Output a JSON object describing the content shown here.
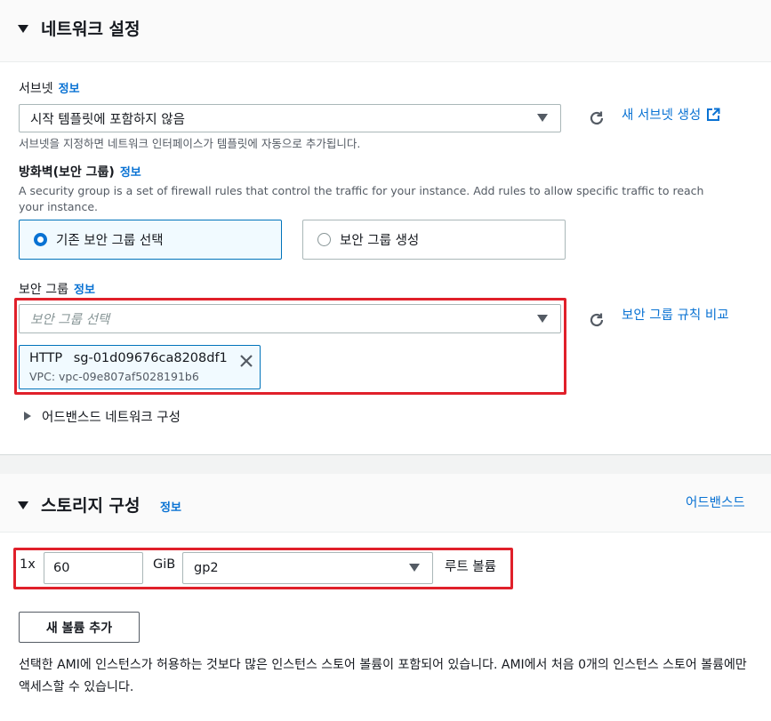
{
  "network": {
    "title": "네트워크 설정",
    "subnet": {
      "label": "서브넷",
      "info": "정보",
      "value": "시작 템플릿에 포함하지 않음",
      "new_link": "새 서브넷 생성",
      "help": "서브넷을 지정하면 네트워크 인터페이스가 템플릿에 자동으로 추가됩니다."
    },
    "firewall": {
      "label": "방화벽(보안 그룹)",
      "info": "정보",
      "desc": "A security group is a set of firewall rules that control the traffic for your instance. Add rules to allow specific traffic to reach your instance.",
      "option_existing": "기존 보안 그룹 선택",
      "option_create": "보안 그룹 생성",
      "selected": "existing"
    },
    "security_group": {
      "label": "보안 그룹",
      "info": "정보",
      "placeholder": "보안 그룹 선택",
      "compare_link": "보안 그룹 규칙 비교",
      "token_name": "HTTP",
      "token_id": "sg-01d09676ca8208df1",
      "token_vpc": "VPC: vpc-09e807af5028191b6"
    },
    "advanced": "어드밴스드 네트워크 구성"
  },
  "storage": {
    "title": "스토리지 구성",
    "info": "정보",
    "advanced_link": "어드밴스드",
    "count_label": "1x",
    "size_value": "60",
    "unit": "GiB",
    "volume_type": "gp2",
    "root_label": "루트 볼륨",
    "add_button": "새 볼륨 추가",
    "note": "선택한 AMI에 인스턴스가 허용하는 것보다 많은 인스턴스 스토어 볼륨이 포함되어 있습니다. AMI에서 처음 0개의 인스턴스 스토어 볼륨에만 액세스할 수 있습니다."
  },
  "colors": {
    "link": "#0972d3",
    "highlight": "#e0202a",
    "selected_border": "#0073bb"
  }
}
